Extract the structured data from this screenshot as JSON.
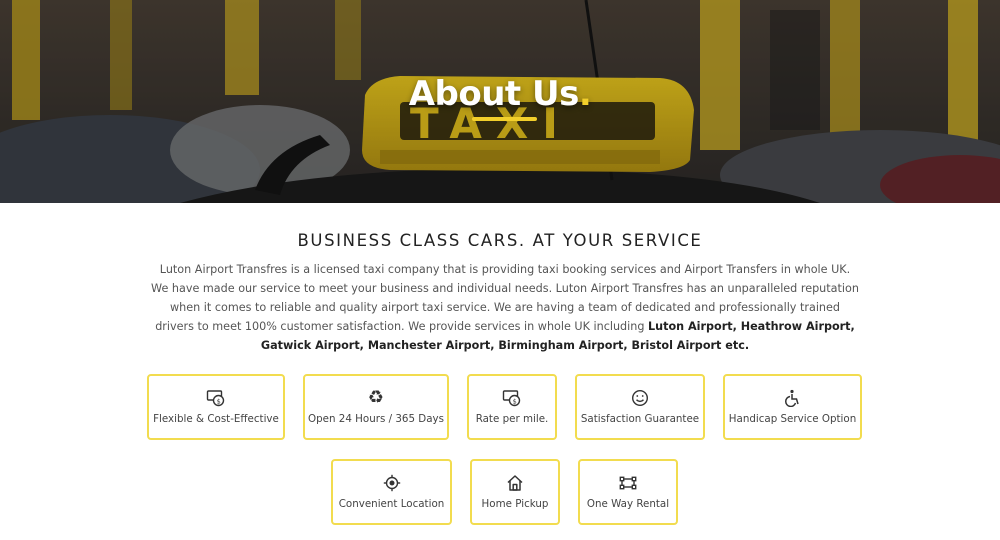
{
  "hero": {
    "title": "About Us",
    "title_dot": ".",
    "accent_color": "#f2cf2b",
    "background_image": "taxi-roof-sign-photo"
  },
  "section": {
    "heading": "BUSINESS CLASS CARS. AT YOUR SERVICE",
    "intro_text": "Luton Airport Transfres is a licensed taxi company that is providing taxi booking services and Airport Transfers in whole UK. We have made our service to meet your business and individual needs. Luton Airport Transfres has an unparalleled reputation when it comes to reliable and quality airport taxi service. We are having a team of dedicated and professionally trained drivers to meet 100% customer satisfaction. We provide services in whole UK including ",
    "intro_bold": "Luton Airport, Heathrow Airport, Gatwick Airport, Manchester Airport, Birmingham Airport, Bristol Airport etc."
  },
  "features": [
    {
      "label": "Flexible & Cost-Effective",
      "icon": "money-icon"
    },
    {
      "label": "Open 24 Hours / 365 Days",
      "icon": "recycle-icon"
    },
    {
      "label": "Rate per mile.",
      "icon": "money-icon"
    },
    {
      "label": "Satisfaction Guarantee",
      "icon": "smile-icon"
    },
    {
      "label": "Handicap Service Option",
      "icon": "wheelchair-icon"
    },
    {
      "label": "Convenient Location",
      "icon": "location-target-icon"
    },
    {
      "label": "Home Pickup",
      "icon": "home-icon"
    },
    {
      "label": "One Way Rental",
      "icon": "route-icon"
    }
  ],
  "colors": {
    "feature_border": "#f2dc4f",
    "heading_text": "#222222",
    "body_text": "#555555"
  }
}
